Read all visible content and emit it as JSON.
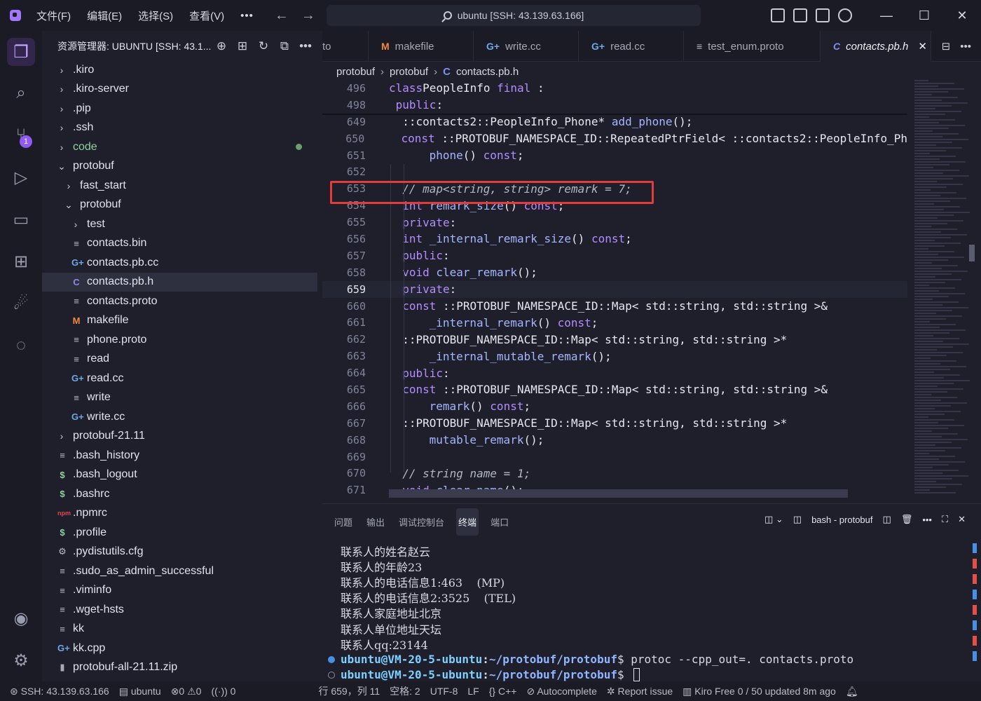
{
  "titlebar": {
    "menus": [
      "文件(F)",
      "编辑(E)",
      "选择(S)",
      "查看(V)"
    ],
    "more": "•••",
    "back": "←",
    "forward": "→",
    "search_text": "ubuntu [SSH: 43.139.63.166]",
    "minimize": "—",
    "maximize": "☐",
    "close": "✕"
  },
  "activity": {
    "scm_badge": "1"
  },
  "explorer": {
    "title": "资源管理器: UBUNTU [SSH: 43.1...",
    "more": "•••",
    "tree": [
      {
        "label": ".kiro",
        "type": "folder",
        "depth": 0,
        "expanded": false
      },
      {
        "label": ".kiro-server",
        "type": "folder",
        "depth": 0,
        "expanded": false
      },
      {
        "label": ".pip",
        "type": "folder",
        "depth": 0,
        "expanded": false
      },
      {
        "label": ".ssh",
        "type": "folder",
        "depth": 0,
        "expanded": false
      },
      {
        "label": "code",
        "type": "folder",
        "depth": 0,
        "expanded": false,
        "modified": true
      },
      {
        "label": "protobuf",
        "type": "folder",
        "depth": 0,
        "expanded": true
      },
      {
        "label": "fast_start",
        "type": "folder",
        "depth": 1,
        "expanded": false
      },
      {
        "label": "protobuf",
        "type": "folder",
        "depth": 1,
        "expanded": true
      },
      {
        "label": "test",
        "type": "folder",
        "depth": 2,
        "expanded": false
      },
      {
        "label": "contacts.bin",
        "type": "lines",
        "depth": 2
      },
      {
        "label": "contacts.pb.cc",
        "type": "cpp",
        "depth": 2
      },
      {
        "label": "contacts.pb.h",
        "type": "h",
        "depth": 2,
        "selected": true
      },
      {
        "label": "contacts.proto",
        "type": "lines",
        "depth": 2
      },
      {
        "label": "makefile",
        "type": "m",
        "depth": 2
      },
      {
        "label": "phone.proto",
        "type": "lines",
        "depth": 2
      },
      {
        "label": "read",
        "type": "lines",
        "depth": 2
      },
      {
        "label": "read.cc",
        "type": "cpp",
        "depth": 2
      },
      {
        "label": "write",
        "type": "lines",
        "depth": 2
      },
      {
        "label": "write.cc",
        "type": "cpp",
        "depth": 2
      },
      {
        "label": "protobuf-21.11",
        "type": "folder",
        "depth": 0,
        "expanded": false
      },
      {
        "label": ".bash_history",
        "type": "lines",
        "depth": 0
      },
      {
        "label": ".bash_logout",
        "type": "dollar",
        "depth": 0
      },
      {
        "label": ".bashrc",
        "type": "dollar",
        "depth": 0
      },
      {
        "label": ".npmrc",
        "type": "npm",
        "depth": 0
      },
      {
        "label": ".profile",
        "type": "dollar",
        "depth": 0
      },
      {
        "label": ".pydistutils.cfg",
        "type": "gear",
        "depth": 0
      },
      {
        "label": ".sudo_as_admin_successful",
        "type": "lines",
        "depth": 0
      },
      {
        "label": ".viminfo",
        "type": "lines",
        "depth": 0
      },
      {
        "label": ".wget-hsts",
        "type": "lines",
        "depth": 0
      },
      {
        "label": "kk",
        "type": "lines",
        "depth": 0
      },
      {
        "label": "kk.cpp",
        "type": "cpp",
        "depth": 0
      },
      {
        "label": "protobuf-all-21.11.zip",
        "type": "zip",
        "depth": 0
      }
    ]
  },
  "editor": {
    "tabs": [
      {
        "label": "to",
        "icon": "",
        "active": false
      },
      {
        "label": "makefile",
        "icon": "M",
        "active": false
      },
      {
        "label": "write.cc",
        "icon": "G+",
        "active": false
      },
      {
        "label": "read.cc",
        "icon": "G+",
        "active": false
      },
      {
        "label": "test_enum.proto",
        "icon": "≡",
        "active": false
      },
      {
        "label": "contacts.pb.h",
        "icon": "C",
        "active": true
      }
    ],
    "tab_close": "✕",
    "more": "•••",
    "breadcrumb": [
      "protobuf",
      "protobuf",
      "contacts.pb.h"
    ],
    "lines": [
      {
        "n": "496",
        "indent": 0,
        "tokens": [
          [
            "kw",
            "class"
          ],
          [
            "",
            "PeopleInfo "
          ],
          [
            "kw",
            "final"
          ],
          [
            "",
            " :"
          ]
        ],
        "sticky": true
      },
      {
        "n": "498",
        "indent": 0,
        "tokens": [
          [
            "kw",
            " public"
          ],
          [
            "",
            ":"
          ]
        ],
        "sticky": true
      },
      {
        "n": "649",
        "indent": 2,
        "tokens": [
          [
            "",
            "::contacts2::PeopleInfo_Phone* "
          ],
          [
            "fn",
            "add_phone"
          ],
          [
            "",
            "();"
          ]
        ]
      },
      {
        "n": "650",
        "indent": 2,
        "tokens": [
          [
            "kw",
            "const"
          ],
          [
            "",
            " ::PROTOBUF_NAMESPACE_ID::RepeatedPtrField< ::contacts2::PeopleInfo_Ph"
          ]
        ]
      },
      {
        "n": "651",
        "indent": 6,
        "tokens": [
          [
            "fn",
            "phone"
          ],
          [
            "",
            "() "
          ],
          [
            "kw",
            "const"
          ],
          [
            "",
            ";"
          ]
        ]
      },
      {
        "n": "652",
        "indent": 0,
        "tokens": []
      },
      {
        "n": "653",
        "indent": 2,
        "tokens": [
          [
            "cm",
            "// map<string, string> remark = 7;"
          ]
        ]
      },
      {
        "n": "654",
        "indent": 2,
        "tokens": [
          [
            "kw",
            "int"
          ],
          [
            "",
            " "
          ],
          [
            "fn",
            "remark_size"
          ],
          [
            "",
            "() "
          ],
          [
            "kw",
            "const"
          ],
          [
            "",
            ";"
          ]
        ]
      },
      {
        "n": "655",
        "indent": 2,
        "tokens": [
          [
            "kw",
            "private"
          ],
          [
            "",
            ":"
          ]
        ]
      },
      {
        "n": "656",
        "indent": 2,
        "tokens": [
          [
            "kw",
            "int"
          ],
          [
            "",
            " "
          ],
          [
            "fn",
            "_internal_remark_size"
          ],
          [
            "",
            "() "
          ],
          [
            "kw",
            "const"
          ],
          [
            "",
            ";"
          ]
        ]
      },
      {
        "n": "657",
        "indent": 2,
        "tokens": [
          [
            "kw",
            "public"
          ],
          [
            "",
            ":"
          ]
        ]
      },
      {
        "n": "658",
        "indent": 2,
        "tokens": [
          [
            "kw",
            "void"
          ],
          [
            "",
            " "
          ],
          [
            "fn",
            "clear_remark"
          ],
          [
            "",
            "();"
          ]
        ]
      },
      {
        "n": "659",
        "indent": 2,
        "tokens": [
          [
            "kw",
            "private"
          ],
          [
            "",
            ":"
          ]
        ],
        "current": true
      },
      {
        "n": "660",
        "indent": 2,
        "tokens": [
          [
            "kw",
            "const"
          ],
          [
            "",
            " ::PROTOBUF_NAMESPACE_ID::Map< std::string, std::string >&"
          ]
        ]
      },
      {
        "n": "661",
        "indent": 6,
        "tokens": [
          [
            "fn",
            "_internal_remark"
          ],
          [
            "",
            "() "
          ],
          [
            "kw",
            "const"
          ],
          [
            "",
            ";"
          ]
        ]
      },
      {
        "n": "662",
        "indent": 2,
        "tokens": [
          [
            "",
            "::PROTOBUF_NAMESPACE_ID::Map< std::string, std::string >*"
          ]
        ]
      },
      {
        "n": "663",
        "indent": 6,
        "tokens": [
          [
            "fn",
            "_internal_mutable_remark"
          ],
          [
            "",
            "();"
          ]
        ]
      },
      {
        "n": "664",
        "indent": 2,
        "tokens": [
          [
            "kw",
            "public"
          ],
          [
            "",
            ":"
          ]
        ]
      },
      {
        "n": "665",
        "indent": 2,
        "tokens": [
          [
            "kw",
            "const"
          ],
          [
            "",
            " ::PROTOBUF_NAMESPACE_ID::Map< std::string, std::string >&"
          ]
        ]
      },
      {
        "n": "666",
        "indent": 6,
        "tokens": [
          [
            "fn",
            "remark"
          ],
          [
            "",
            "() "
          ],
          [
            "kw",
            "const"
          ],
          [
            "",
            ";"
          ]
        ]
      },
      {
        "n": "667",
        "indent": 2,
        "tokens": [
          [
            "",
            "::PROTOBUF_NAMESPACE_ID::Map< std::string, std::string >*"
          ]
        ]
      },
      {
        "n": "668",
        "indent": 6,
        "tokens": [
          [
            "fn",
            "mutable_remark"
          ],
          [
            "",
            "();"
          ]
        ]
      },
      {
        "n": "669",
        "indent": 0,
        "tokens": []
      },
      {
        "n": "670",
        "indent": 2,
        "tokens": [
          [
            "cm",
            "// string name = 1;"
          ]
        ]
      },
      {
        "n": "671",
        "indent": 2,
        "tokens": [
          [
            "kw",
            "void"
          ],
          [
            "",
            " "
          ],
          [
            "fn",
            "clear_name"
          ],
          [
            "",
            "();"
          ]
        ]
      }
    ]
  },
  "panel": {
    "tabs": [
      "问题",
      "输出",
      "调试控制台",
      "终端",
      "端口"
    ],
    "active_tab": "终端",
    "terminal_name": "bash - protobuf",
    "terminal_lines": [
      "联系人的姓名赵云",
      "联系人的年龄23",
      "联系人的电话信息1:463    (MP)",
      "联系人的电话信息2:3525    (TEL)",
      "联系人家庭地址北京",
      "联系人单位地址天坛",
      "联系人qq:23144"
    ],
    "prompt_user": "ubuntu@VM-20-5-ubuntu",
    "prompt_path": "~/protobuf/protobuf",
    "command": "protoc --cpp_out=. contacts.proto"
  },
  "statusbar": {
    "remote": "SSH: 43.139.63.166",
    "workspace": "ubuntu",
    "errors": "0",
    "warnings": "0",
    "ports": "0",
    "cursor_pos": "行 659，列 11",
    "spaces": "空格: 2",
    "encoding": "UTF-8",
    "eol": "LF",
    "language": "C++",
    "autocomplete": "Autocomplete",
    "report": "Report issue",
    "kiro": "Kiro Free 0 / 50 updated 8m ago"
  },
  "colors": {
    "accent": "#a277ff",
    "highlight_box": "#e23b3b",
    "keyword": "#b58cff",
    "function": "#a3b6ff"
  }
}
